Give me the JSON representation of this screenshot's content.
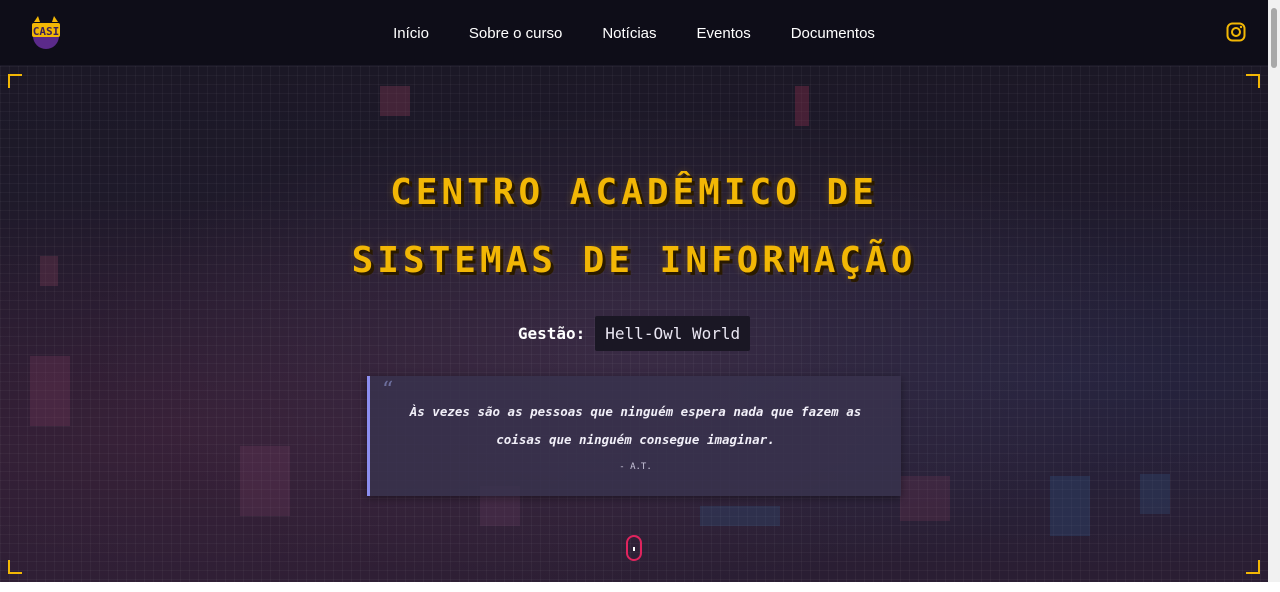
{
  "logo": {
    "text": "CASI",
    "icon": "casi-owl-logo"
  },
  "nav": {
    "items": [
      {
        "label": "Início"
      },
      {
        "label": "Sobre o curso"
      },
      {
        "label": "Notícias"
      },
      {
        "label": "Eventos"
      },
      {
        "label": "Documentos"
      }
    ],
    "social_icon": "instagram-icon"
  },
  "hero": {
    "title_line1": "CENTRO ACADÊMICO DE",
    "title_line2": "SISTEMAS DE INFORMAÇÃO",
    "gestao_label": "Gestão:",
    "gestao_value": "Hell-Owl World",
    "quote_mark": "“",
    "quote_text": "Às vezes são as pessoas que ninguém espera nada que fazem as coisas que ninguém consegue imaginar.",
    "quote_author": "- A.T."
  },
  "colors": {
    "accent": "#f2b705",
    "quote_border": "#8c8ef0",
    "scroll_indicator": "#e0245e",
    "background": "#1b1826"
  }
}
